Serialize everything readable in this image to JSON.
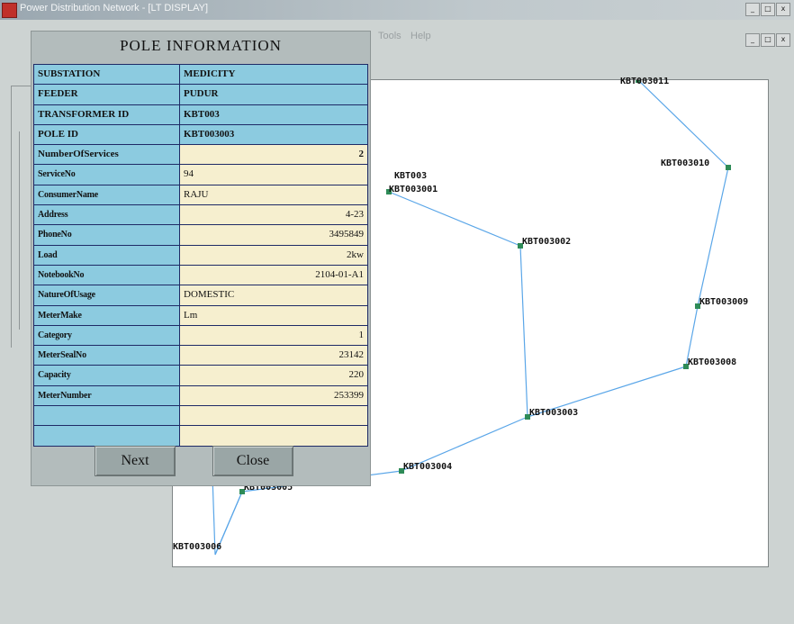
{
  "window": {
    "title": "Power Distribution Network - [LT DISPLAY]",
    "controls": [
      "_",
      "□",
      "x"
    ]
  },
  "menubar": {
    "items": [
      "Tools",
      "Help"
    ]
  },
  "dialog": {
    "title": "POLE INFORMATION",
    "header_rows": [
      {
        "label": "SUBSTATION",
        "value": "MEDICITY"
      },
      {
        "label": "FEEDER",
        "value": "PUDUR"
      },
      {
        "label": "TRANSFORMER ID",
        "value": "KBT003"
      },
      {
        "label": "POLE ID",
        "value": "KBT003003"
      }
    ],
    "services_row": {
      "label": "NumberOfServices",
      "value": "2"
    },
    "service_rows": [
      {
        "label": "ServiceNo",
        "value": "94",
        "align": "left"
      },
      {
        "label": "ConsumerName",
        "value": "RAJU",
        "align": "left"
      },
      {
        "label": "Address",
        "value": "4-23",
        "align": "right"
      },
      {
        "label": "PhoneNo",
        "value": "3495849",
        "align": "right"
      },
      {
        "label": "Load",
        "value": "2kw",
        "align": "right"
      },
      {
        "label": "NotebookNo",
        "value": "2104-01-A1",
        "align": "right"
      },
      {
        "label": "NatureOfUsage",
        "value": "DOMESTIC",
        "align": "left"
      },
      {
        "label": "MeterMake",
        "value": "Lm",
        "align": "left"
      },
      {
        "label": "Category",
        "value": "1",
        "align": "right"
      },
      {
        "label": "MeterSealNo",
        "value": "23142",
        "align": "right"
      },
      {
        "label": "Capacity",
        "value": "220",
        "align": "right"
      },
      {
        "label": "MeterNumber",
        "value": "253399",
        "align": "right"
      },
      {
        "label": "",
        "value": "",
        "align": "left"
      },
      {
        "label": "",
        "value": "",
        "align": "left"
      }
    ],
    "next_label": "Next",
    "close_label": "Close"
  },
  "map": {
    "nodes": [
      {
        "id": "n011",
        "label": "KBT003011"
      },
      {
        "id": "n010",
        "label": "KBT003010"
      },
      {
        "id": "n003",
        "label": "KBT003"
      },
      {
        "id": "n001",
        "label": "KBT003001"
      },
      {
        "id": "n002",
        "label": "KBT003002"
      },
      {
        "id": "n009",
        "label": "KBT003009"
      },
      {
        "id": "n008",
        "label": "KBT003008"
      },
      {
        "id": "n003b",
        "label": "KBT003003"
      },
      {
        "id": "n004",
        "label": "KBT003004"
      },
      {
        "id": "n005",
        "label": "KBT003005"
      },
      {
        "id": "n006",
        "label": "KBT003006"
      }
    ],
    "line_color": "#5aa6e8",
    "node_color": "#2e8b57"
  }
}
